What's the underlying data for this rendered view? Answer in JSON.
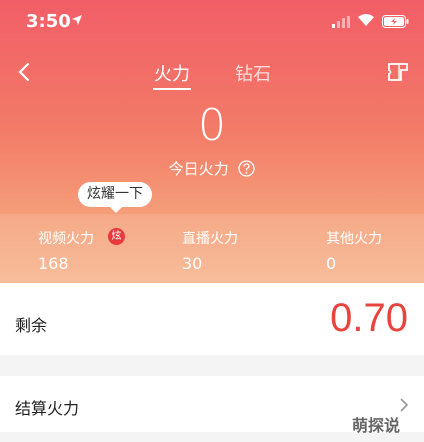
{
  "status_bar": {
    "time": "3:50"
  },
  "nav": {
    "tabs": [
      {
        "label": "火力"
      },
      {
        "label": "钻石"
      }
    ]
  },
  "today": {
    "value": "0",
    "label": "今日火力"
  },
  "bubble": {
    "text": "炫耀一下"
  },
  "stats": [
    {
      "label": "视频火力",
      "value": "168",
      "badge": "炫"
    },
    {
      "label": "直播火力",
      "value": "30"
    },
    {
      "label": "其他火力",
      "value": "0"
    }
  ],
  "remaining": {
    "label": "剩余",
    "value": "0.70"
  },
  "settle": {
    "label": "结算火力"
  },
  "watermark": {
    "text": "萌探说"
  },
  "colors": {
    "accent_red": "#e8443e",
    "header_top": "#f25e67",
    "header_bottom": "#f6b48c"
  }
}
